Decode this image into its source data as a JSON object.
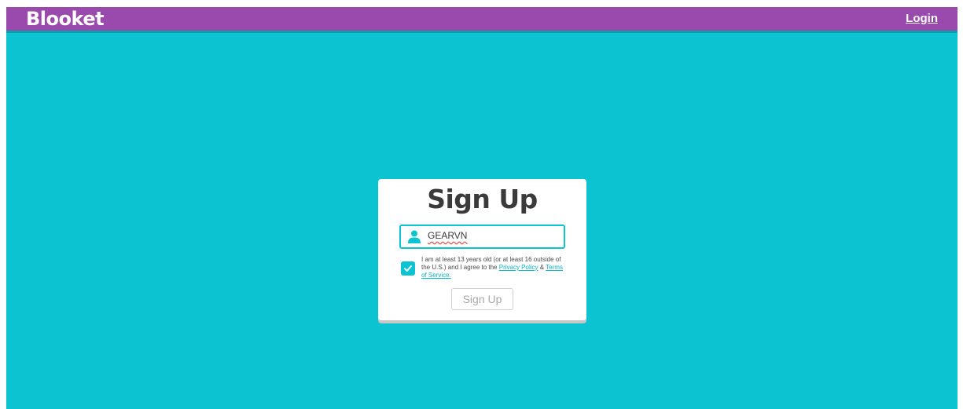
{
  "header": {
    "brand": "Blooket",
    "login_label": "Login",
    "background_color": "#9a4aad"
  },
  "page": {
    "background_color": "#0bc3d1"
  },
  "signup_card": {
    "title": "Sign Up",
    "username": {
      "value": "GEARVN",
      "icon": "user-icon"
    },
    "agreement": {
      "checked": true,
      "text_prefix": "I am at least 13 years old (or at least 16 outside of the U.S.) and I agree to the ",
      "privacy_link": "Privacy Policy",
      "separator": " & ",
      "terms_link": "Terms of Service."
    },
    "submit_label": "Sign Up"
  }
}
